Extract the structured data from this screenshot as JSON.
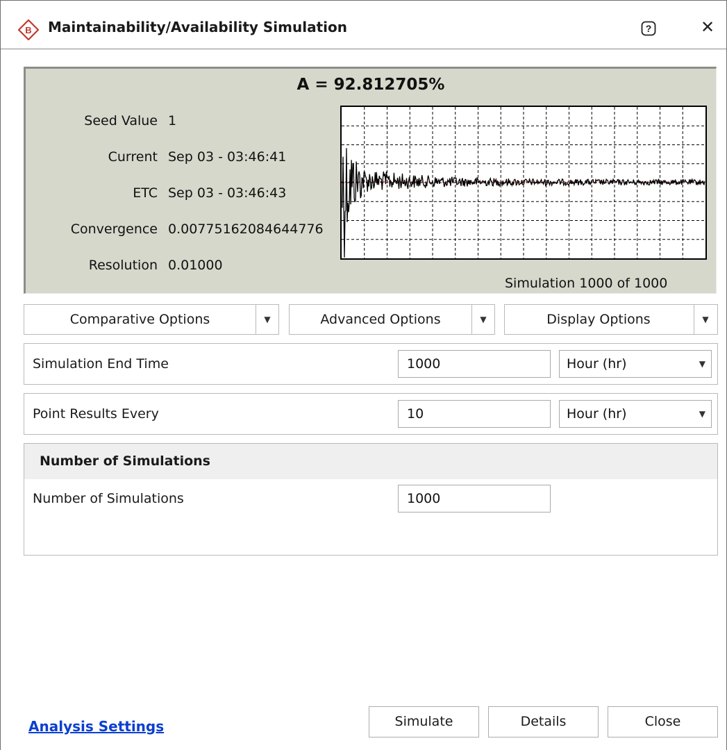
{
  "window": {
    "title": "Maintainability/Availability Simulation",
    "app_icon": "b-diamond-icon",
    "help_icon": "help-icon",
    "close_icon": "close-icon",
    "close_glyph": "✕"
  },
  "status": {
    "availability": "A = 92.812705%",
    "seed_label": "Seed Value",
    "seed_value": "1",
    "current_label": "Current",
    "current_value": "Sep 03 - 03:46:41",
    "etc_label": "ETC",
    "etc_value": "Sep 03 - 03:46:43",
    "convergence_label": "Convergence",
    "convergence_value": "0.00775162084644776",
    "resolution_label": "Resolution",
    "resolution_value": "0.01000",
    "simulation_count": "Simulation 1000 of 1000",
    "panel_color": "#d7d8cc"
  },
  "chart_data": {
    "type": "line",
    "title": "",
    "xlabel": "",
    "ylabel": "",
    "x_range": [
      0,
      1000
    ],
    "grid": true,
    "reference_line_color": "#cc2222",
    "series_color": "#000000",
    "note_converged_fraction": 0.72
  },
  "options": {
    "comparative": "Comparative Options",
    "advanced": "Advanced Options",
    "display": "Display Options",
    "arrow": "▼"
  },
  "end_time": {
    "label": "Simulation End Time",
    "value": "1000",
    "unit": "Hour (hr)"
  },
  "point_results": {
    "label": "Point Results Every",
    "value": "10",
    "unit": "Hour (hr)"
  },
  "simulations": {
    "group_title": "Number of Simulations",
    "label": "Number of Simulations",
    "value": "1000"
  },
  "footer": {
    "link": "Analysis Settings",
    "simulate": "Simulate",
    "details": "Details",
    "close": "Close"
  },
  "colors": {
    "link": "#0b3fd0",
    "icon_red": "#c0392b"
  }
}
